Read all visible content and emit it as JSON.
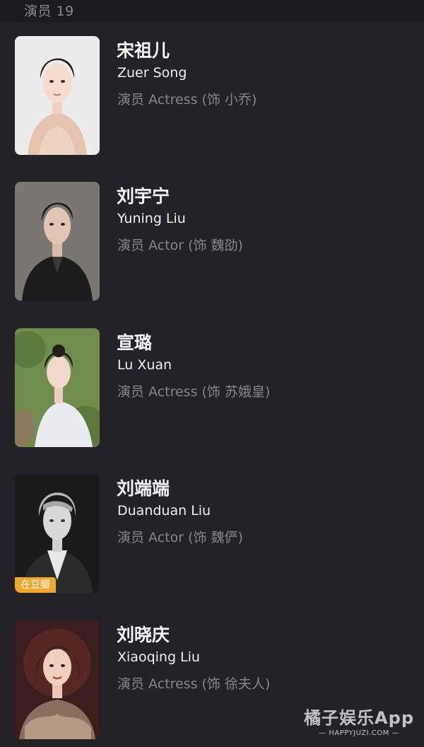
{
  "section": {
    "title": "演员 19"
  },
  "cast": [
    {
      "name_cn": "宋祖儿",
      "name_en": "Zuer Song",
      "role": "演员 Actress (饰 小乔)"
    },
    {
      "name_cn": "刘宇宁",
      "name_en": "Yuning Liu",
      "role": "演员 Actor (饰 魏劭)"
    },
    {
      "name_cn": "宣璐",
      "name_en": "Lu Xuan",
      "role": "演员 Actress (饰 苏娥皇)"
    },
    {
      "name_cn": "刘端端",
      "name_en": "Duanduan Liu",
      "role": "演员 Actor (饰 魏俨)",
      "badge": "在豆瓣"
    },
    {
      "name_cn": "刘晓庆",
      "name_en": "Xiaoqing Liu",
      "role": "演员 Actress (饰 徐夫人)"
    }
  ],
  "watermark": {
    "logo": "橘子娱乐App",
    "url": "— HAPPYJUZI.COM —"
  },
  "colors": {
    "background": "#232228",
    "header_background": "#1b1a1f",
    "badge": "#f2a62a",
    "secondary_text": "#86858b"
  }
}
